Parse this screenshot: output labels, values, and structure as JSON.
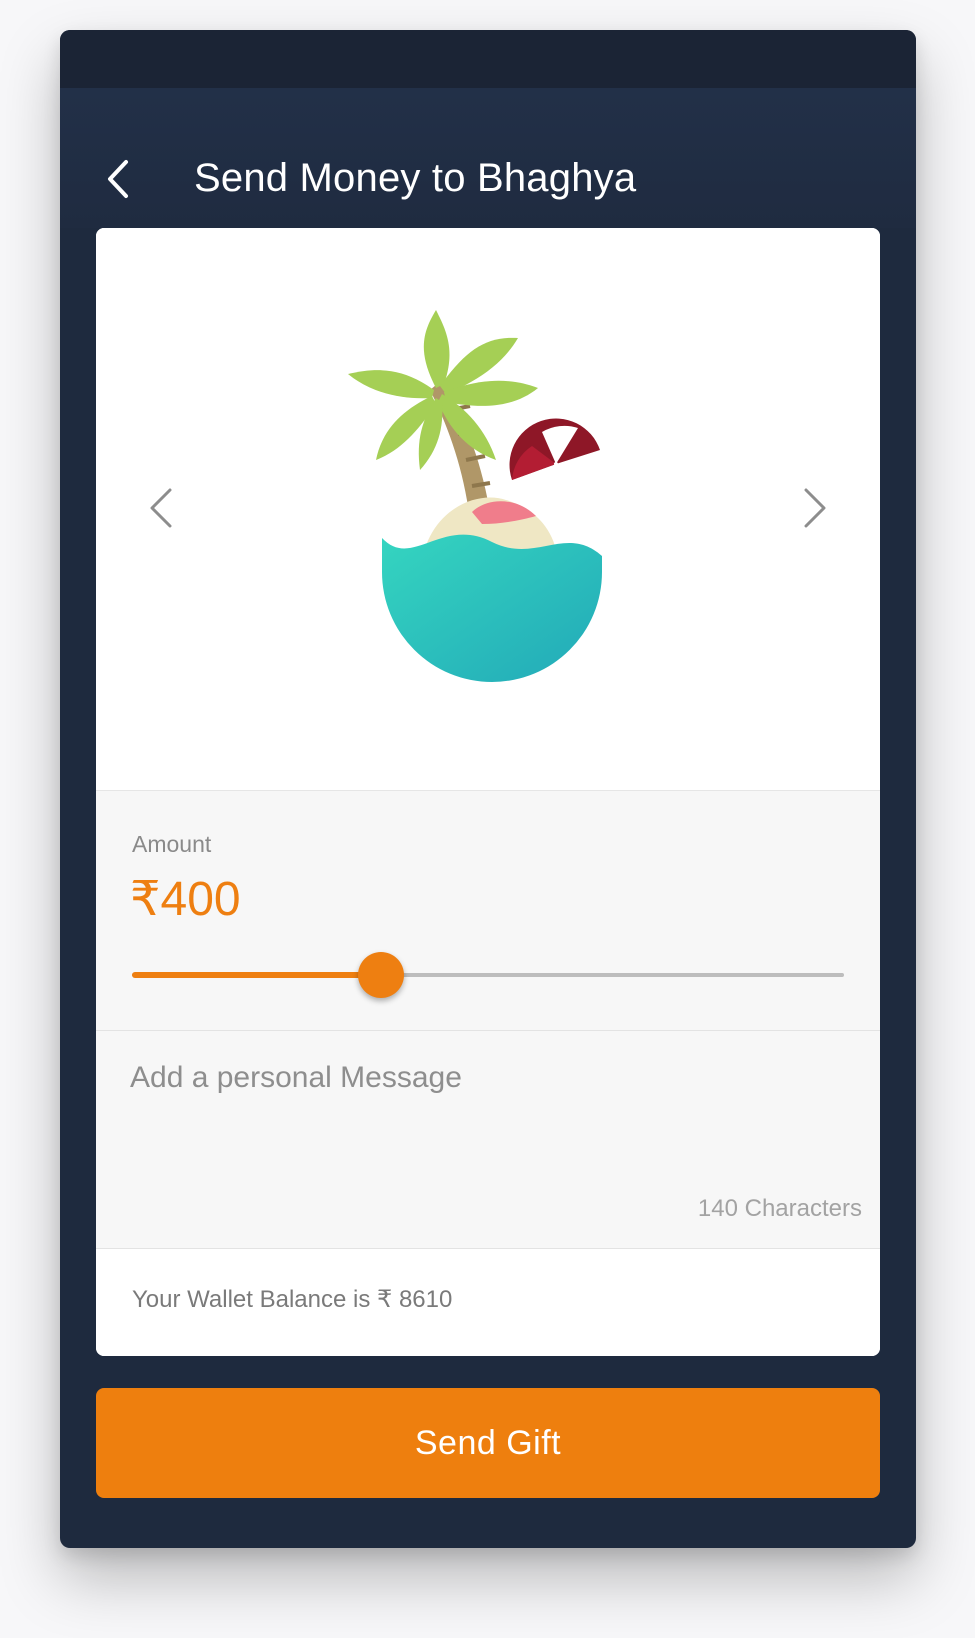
{
  "header": {
    "title": "Send Money to Bhaghya",
    "back_icon": "back-arrow-icon"
  },
  "gift": {
    "illustration": "island-coconut-illustration",
    "prev_icon": "chevron-left-icon",
    "next_icon": "chevron-right-icon"
  },
  "amount": {
    "label": "Amount",
    "value": "₹400",
    "slider_level": 0.35
  },
  "message": {
    "placeholder": "Add a personal Message",
    "value": "",
    "char_limit_text": "140 Characters"
  },
  "wallet": {
    "text": "Your Wallet Balance is ₹ 8610"
  },
  "actions": {
    "send_label": "Send Gift"
  },
  "colors": {
    "accent": "#ee7f11",
    "background": "#1e2a3e",
    "card": "#ffffff"
  }
}
